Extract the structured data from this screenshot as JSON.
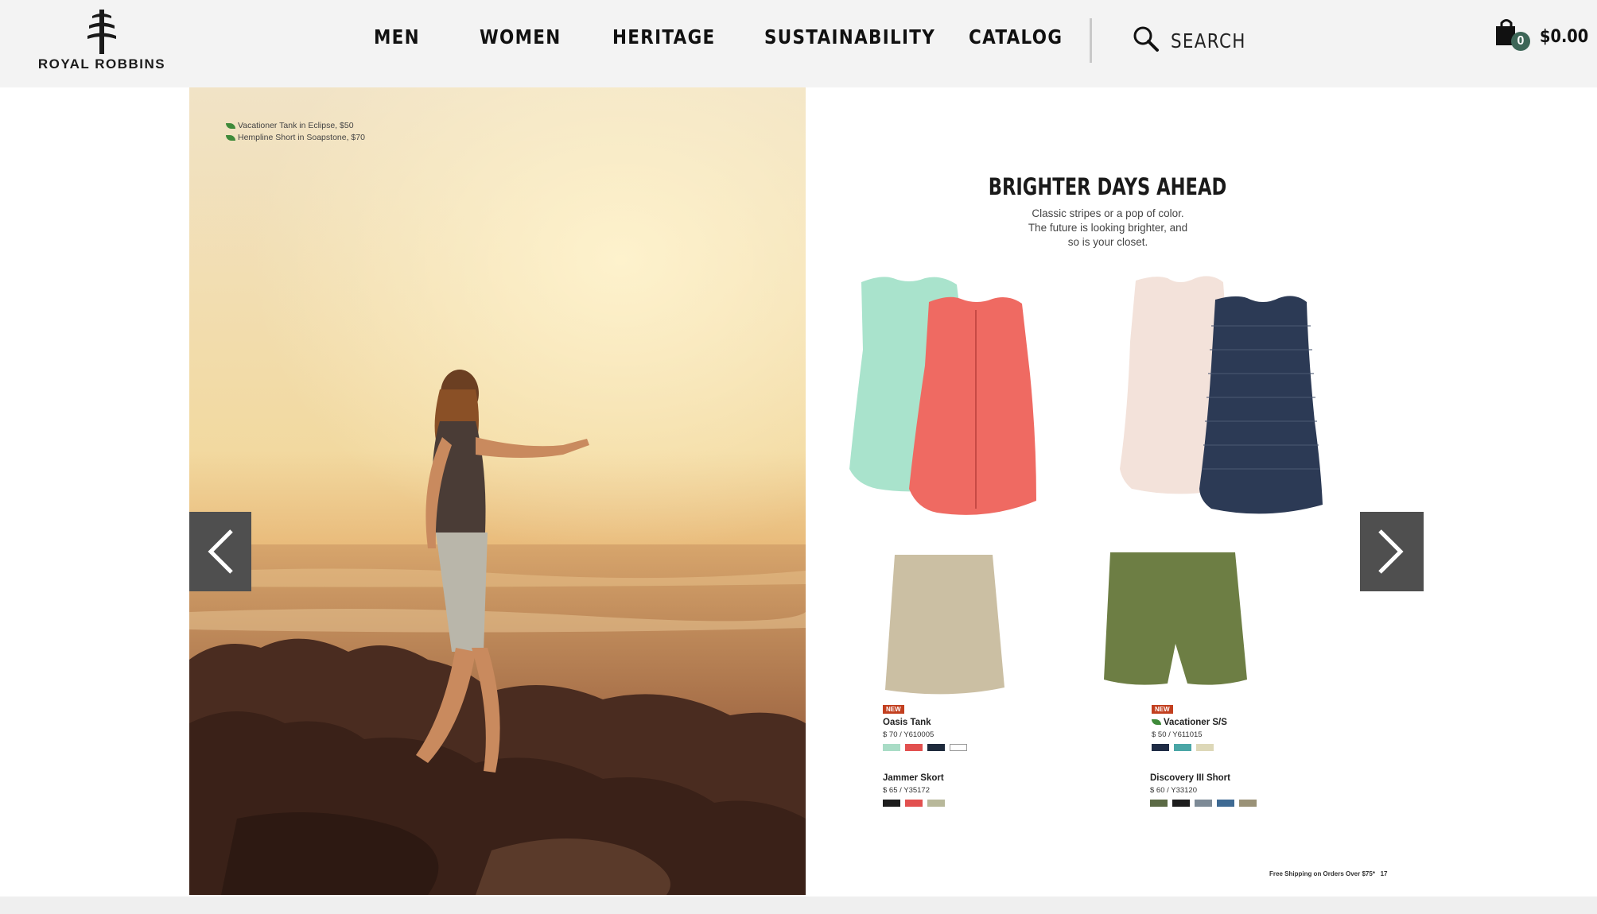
{
  "brand": {
    "name": "ROYAL ROBBINS"
  },
  "nav": {
    "items": [
      {
        "label": "MEN"
      },
      {
        "label": "WOMEN"
      },
      {
        "label": "HERITAGE"
      },
      {
        "label": "SUSTAINABILITY"
      },
      {
        "label": "CATALOG"
      }
    ]
  },
  "search": {
    "placeholder": "SEARCH"
  },
  "cart": {
    "count": "0",
    "total": "$0.00",
    "icon": "shopping-bag-icon"
  },
  "catalog": {
    "photo_caption": [
      "Vacationer Tank in Eclipse, $50",
      "Hempline Short in Soapstone, $70"
    ],
    "title": "BRIGHTER DAYS AHEAD",
    "subtitle": [
      "Classic stripes or a pop of color.",
      "The future is looking brighter, and",
      "so is your closet."
    ],
    "products": [
      {
        "tag": "NEW",
        "name": "Oasis Tank",
        "price": "$ 70 / Y610005",
        "swatches": [
          "#a9dcc6",
          "#e2504f",
          "#1e2a3c",
          "#ffffff"
        ]
      },
      {
        "tag": "NEW",
        "name": "Vacationer S/S",
        "price": "$ 50 / Y611015",
        "swatches": [
          "#1f2c45",
          "#4aa6a6",
          "#ddd8b8"
        ]
      },
      {
        "name": "Jammer Skort",
        "price": "$ 65 / Y35172",
        "swatches": [
          "#1d1d1d",
          "#e2504f",
          "#b8b89a"
        ]
      },
      {
        "name": "Discovery III Short",
        "price": "$ 60 / Y33120",
        "swatches": [
          "#5b6a45",
          "#1d1d1d",
          "#7d8a96",
          "#3e6a93",
          "#9a9277"
        ]
      }
    ],
    "footer_note": "Free Shipping on Orders Over $75*",
    "page_number": "17"
  },
  "colors": {
    "header_bg": "#f3f3f3",
    "arrow_bg": "#4f4f4f",
    "badge": "#3d6657",
    "new_tag": "#c23f1f"
  }
}
